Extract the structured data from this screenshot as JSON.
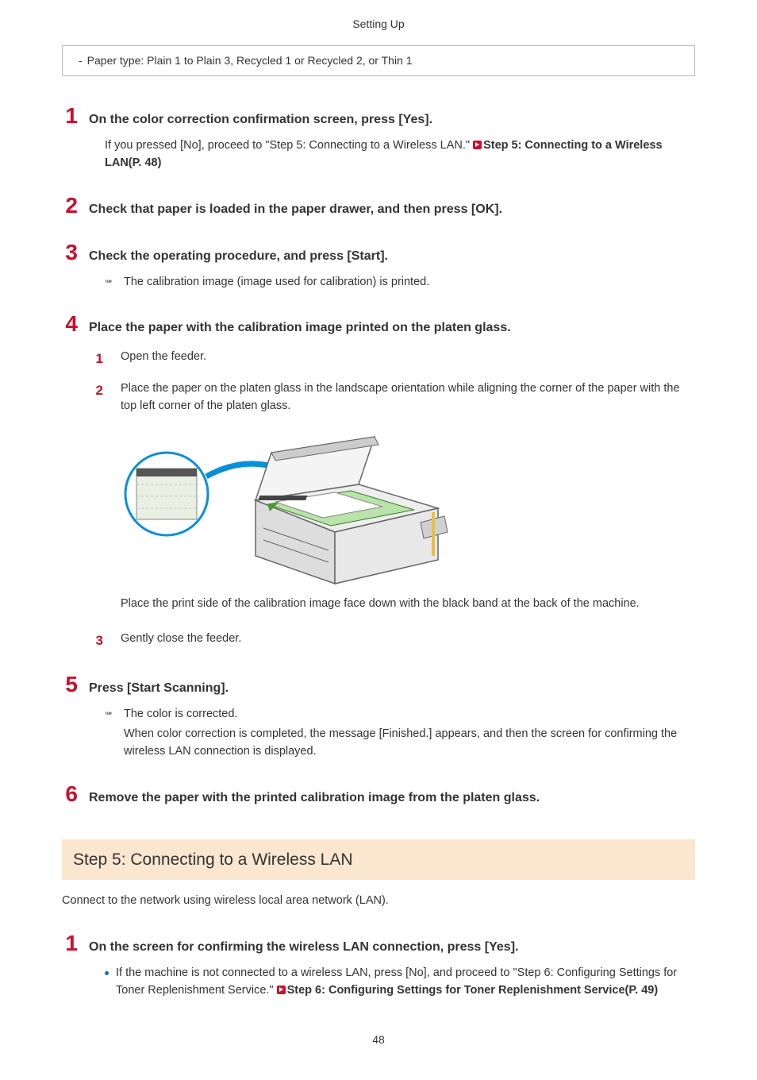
{
  "header": "Setting Up",
  "note_box": "Paper type: Plain 1 to Plain 3, Recycled 1 or Recycled 2, or Thin 1",
  "steps": {
    "s1": {
      "num": "1",
      "title": "On the color correction confirmation screen, press [Yes].",
      "body_pre": "If you pressed [No], proceed to \"Step 5: Connecting to a Wireless LAN.\" ",
      "link": "Step 5: Connecting to a Wireless LAN(P. 48)"
    },
    "s2": {
      "num": "2",
      "title": "Check that paper is loaded in the paper drawer, and then press [OK]."
    },
    "s3": {
      "num": "3",
      "title": "Check the operating procedure, and press [Start].",
      "result": "The calibration image (image used for calibration) is printed."
    },
    "s4": {
      "num": "4",
      "title": "Place the paper with the calibration image printed on the platen glass.",
      "sub1": {
        "num": "1",
        "text": "Open the feeder."
      },
      "sub2": {
        "num": "2",
        "text": "Place the paper on the platen glass in the landscape orientation while aligning the corner of the paper with the top left corner of the platen glass.",
        "caption": "Place the print side of the calibration image face down with the black band at the back of the machine."
      },
      "sub3": {
        "num": "3",
        "text": "Gently close the feeder."
      }
    },
    "s5": {
      "num": "5",
      "title": "Press [Start Scanning].",
      "result": "The color is corrected.",
      "follow": "When color correction is completed, the message [Finished.] appears, and then the screen for confirming the wireless LAN connection is displayed."
    },
    "s6": {
      "num": "6",
      "title": "Remove the paper with the printed calibration image from the platen glass."
    }
  },
  "section5": {
    "title": "Step 5: Connecting to a Wireless LAN",
    "intro": "Connect to the network using wireless local area network (LAN).",
    "s1": {
      "num": "1",
      "title": "On the screen for confirming the wireless LAN connection, press [Yes].",
      "bullet_pre": "If the machine is not connected to a wireless LAN, press [No], and proceed to \"Step 6: Configuring Settings for Toner Replenishment Service.\" ",
      "bullet_link": "Step 6: Configuring Settings for Toner Replenishment Service(P. 49)"
    }
  },
  "page_num": "48"
}
